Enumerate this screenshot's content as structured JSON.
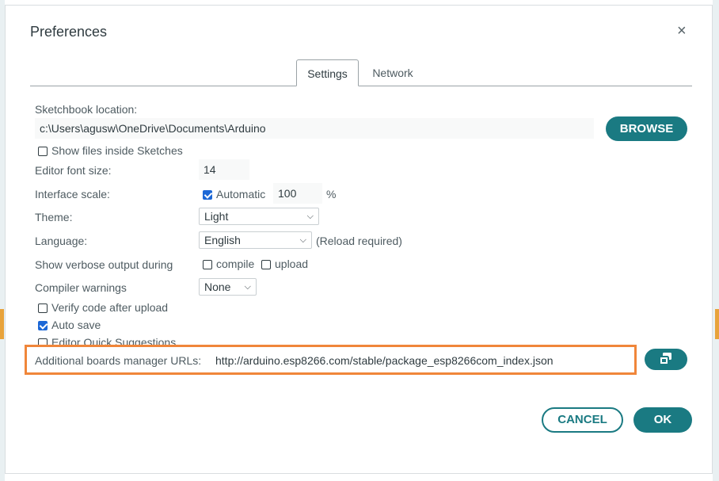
{
  "dialog": {
    "title": "Preferences",
    "close_glyph": "×"
  },
  "tabs": [
    {
      "label": "Settings",
      "active": true
    },
    {
      "label": "Network",
      "active": false
    }
  ],
  "sketchbook": {
    "label": "Sketchbook location:",
    "value": "c:\\Users\\agusw\\OneDrive\\Documents\\Arduino",
    "browse_label": "BROWSE"
  },
  "show_files": {
    "label": "Show files inside Sketches",
    "checked": false
  },
  "font_size": {
    "label": "Editor font size:",
    "value": "14"
  },
  "interface_scale": {
    "label": "Interface scale:",
    "automatic_label": "Automatic",
    "automatic_checked": true,
    "value": "100",
    "unit": "%"
  },
  "theme": {
    "label": "Theme:",
    "value": "Light"
  },
  "language": {
    "label": "Language:",
    "value": "English",
    "note": "(Reload required)"
  },
  "verbose": {
    "label": "Show verbose output during",
    "compile_label": "compile",
    "upload_label": "upload"
  },
  "compiler_warnings": {
    "label": "Compiler warnings",
    "value": "None"
  },
  "verify": {
    "label": "Verify code after upload",
    "checked": false
  },
  "auto_save": {
    "label": "Auto save",
    "checked": true
  },
  "quick_suggestions": {
    "label": "Editor Quick Suggestions",
    "checked": false
  },
  "board_urls": {
    "label": "Additional boards manager URLs:",
    "value": "http://arduino.esp8266.com/stable/package_esp8266com_index.json"
  },
  "footer": {
    "cancel_label": "CANCEL",
    "ok_label": "OK"
  },
  "colors": {
    "accent": "#1a7a82",
    "highlight": "#f0863a",
    "checkbox": "#1c67d6"
  },
  "icons": {
    "close": "close-icon",
    "chevron": "chevron-down-icon",
    "open_window": "open-window-icon"
  }
}
